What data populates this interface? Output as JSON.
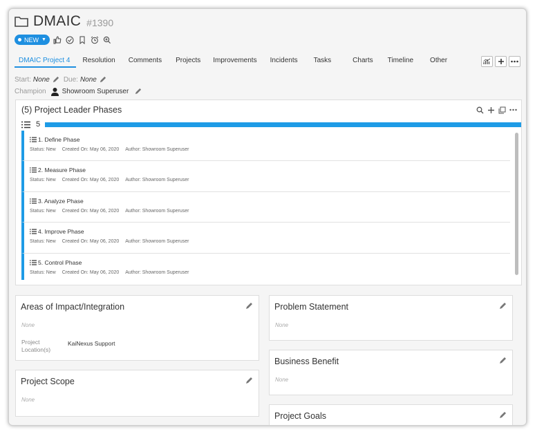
{
  "header": {
    "title": "DMAIC",
    "id": "#1390"
  },
  "toolbar": {
    "status_label": "NEW"
  },
  "tabs": [
    {
      "label": "DMAIC Project 4"
    },
    {
      "label": "Resolution"
    },
    {
      "label": "Comments"
    },
    {
      "label": "Projects"
    },
    {
      "label": "Improvements"
    },
    {
      "label": "Incidents"
    },
    {
      "label": "Tasks"
    },
    {
      "label": "Charts"
    },
    {
      "label": "Timeline"
    },
    {
      "label": "Other"
    }
  ],
  "meta": {
    "start_label": "Start:",
    "start_value": "None",
    "due_label": "Due:",
    "due_value": "None",
    "champion_label": "Champion",
    "champion_name": "Showroom Superuser"
  },
  "phases": {
    "title": "(5) Project Leader Phases",
    "count": "5",
    "items": [
      {
        "name": "1. Define Phase",
        "status": "Status: New",
        "created": "Created On: May 06, 2020",
        "author": "Author: Showroom Superuser"
      },
      {
        "name": "2. Measure Phase",
        "status": "Status: New",
        "created": "Created On: May 06, 2020",
        "author": "Author: Showroom Superuser"
      },
      {
        "name": "3. Analyze Phase",
        "status": "Status: New",
        "created": "Created On: May 06, 2020",
        "author": "Author: Showroom Superuser"
      },
      {
        "name": "4. Improve Phase",
        "status": "Status: New",
        "created": "Created On: May 06, 2020",
        "author": "Author: Showroom Superuser"
      },
      {
        "name": "5. Control Phase",
        "status": "Status: New",
        "created": "Created On: May 06, 2020",
        "author": "Author: Showroom Superuser"
      }
    ]
  },
  "cards": {
    "areas": {
      "title": "Areas of Impact/Integration",
      "none": "None",
      "location_label": "Project Location(s)",
      "location_value": "KaiNexus Support"
    },
    "scope": {
      "title": "Project Scope",
      "none": "None"
    },
    "problem": {
      "title": "Problem Statement",
      "none": "None"
    },
    "benefit": {
      "title": "Business Benefit",
      "none": "None"
    },
    "goals": {
      "title": "Project Goals"
    }
  },
  "colors": {
    "accent": "#1e8fe0",
    "bar": "#1e9be6"
  }
}
